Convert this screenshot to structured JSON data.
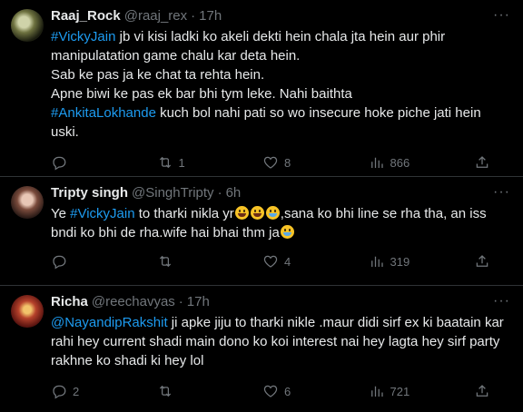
{
  "tweets": [
    {
      "name": "Raaj_Rock",
      "handle": "@raaj_rex",
      "time": "17h",
      "text_lines": [
        {
          "link": "#VickyJain",
          "rest": " jb vi kisi ladki ko akeli dekti hein chala jta hein aur phir manipulatation game chalu kar deta hein."
        },
        {
          "rest": "Sab ke pas ja ke chat ta rehta hein."
        },
        {
          "rest": "Apne biwi ke pas ek bar bhi tym leke. Nahi baithta"
        },
        {
          "link": "#AnkitaLokhande",
          "rest": " kuch bol nahi pati so wo insecure hoke piche jati hein uski."
        }
      ],
      "replies": "",
      "retweets": "1",
      "likes": "8",
      "views": "866"
    },
    {
      "name": "Tripty singh",
      "handle": "@SinghTripty",
      "time": "6h",
      "text_prefix": "Ye ",
      "text_link": "#VickyJain",
      "text_mid": " to tharki nikla yr",
      "text_after": ",sana ko bhi line se rha tha, an iss bndi ko bhi de rha.wife hai bhai thm ja",
      "replies": "",
      "retweets": "",
      "likes": "4",
      "views": "319"
    },
    {
      "name": "Richa",
      "handle": "@reechavyas",
      "time": "17h",
      "text_link": "@NayandipRakshit",
      "text_rest": " ji apke jiju to tharki nikle .maur didi sirf ex ki baatain kar rahi hey current shadi main dono ko koi interest nai hey lagta hey sirf party rakhne ko shadi ki hey lol",
      "replies": "2",
      "retweets": "",
      "likes": "6",
      "views": "721"
    }
  ],
  "icons": {
    "reply": "reply-icon",
    "retweet": "retweet-icon",
    "like": "heart-icon",
    "views": "views-icon",
    "share": "share-icon",
    "more": "more-icon"
  },
  "colors": {
    "background": "#000000",
    "text": "#e7e9ea",
    "muted": "#71767b",
    "link": "#1d9bf0",
    "divider": "#2f3336"
  }
}
